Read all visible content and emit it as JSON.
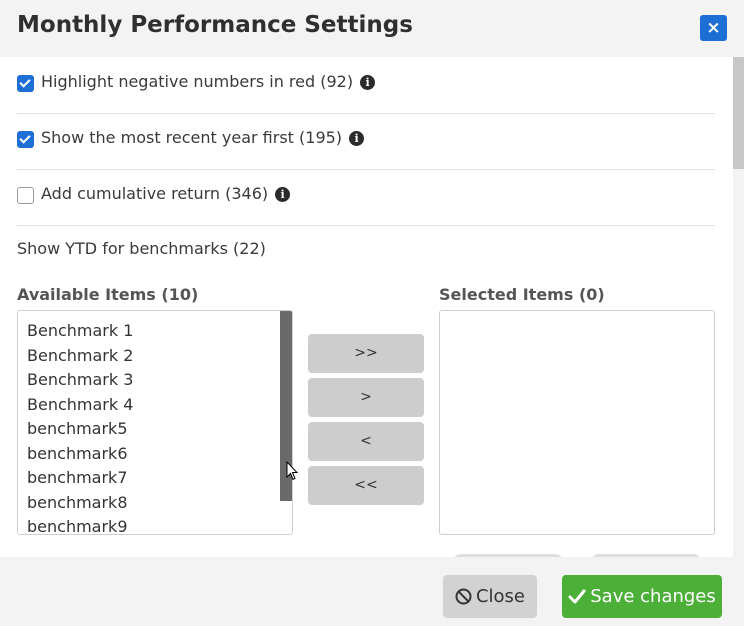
{
  "dialog": {
    "title": "Monthly Performance Settings",
    "close_icon_glyph": "×"
  },
  "options": [
    {
      "label": "Highlight negative numbers in red (92)",
      "checked": true
    },
    {
      "label": "Show the most recent year first (195)",
      "checked": true
    },
    {
      "label": "Add cumulative return (346)",
      "checked": false
    }
  ],
  "ytd_label": "Show YTD for benchmarks (22)",
  "info_glyph": "i",
  "available": {
    "label": "Available Items (10)",
    "items": [
      "Benchmark 1",
      "Benchmark 2",
      "Benchmark 3",
      "Benchmark 4",
      "benchmark5",
      "benchmark6",
      "benchmark7",
      "benchmark8",
      "benchmark9"
    ]
  },
  "selected": {
    "label": "Selected Items (0)",
    "items": []
  },
  "move_buttons": {
    "add_all": ">>",
    "add": ">",
    "remove": "<",
    "remove_all": "<<"
  },
  "footer": {
    "close_label": "Close",
    "save_label": "Save changes"
  },
  "colors": {
    "primary": "#1d6fd6",
    "success": "#4caf38",
    "header_bg": "#f3f3f3"
  }
}
